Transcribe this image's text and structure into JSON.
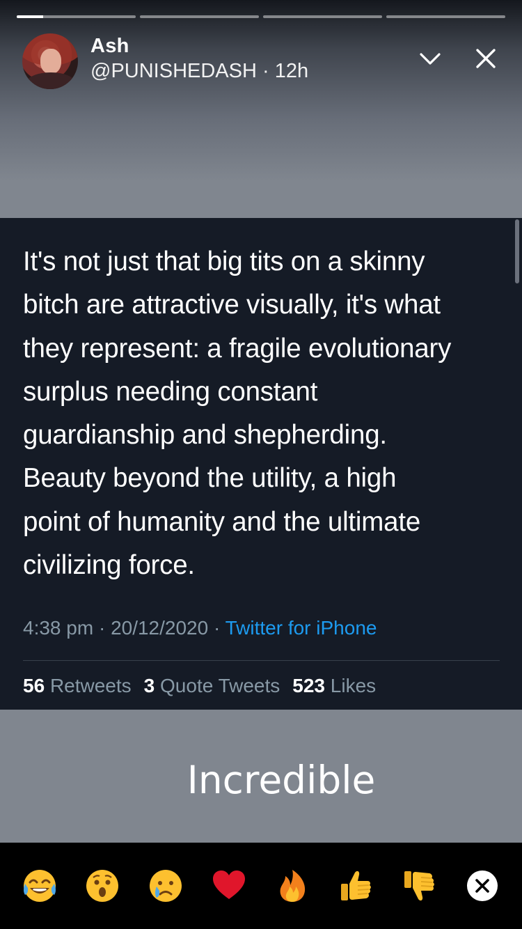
{
  "story": {
    "progress": [
      0.22,
      0,
      0,
      0
    ]
  },
  "header": {
    "name": "Ash",
    "handle": "@PUNISHEDASH",
    "separator": " · ",
    "time": "12h"
  },
  "tweet": {
    "lines": [
      "It's not just that big tits on a skinny",
      "bitch are attractive visually, it's what",
      "they represent: a fragile evolutionary",
      "surplus needing constant",
      "guardianship and shepherding.",
      "Beauty beyond the utility, a high",
      "point of humanity and the ultimate",
      "civilizing force."
    ],
    "time": "4:38 pm",
    "date": "20/12/2020",
    "separator": " · ",
    "source": "Twitter for iPhone",
    "retweets_count": "56",
    "retweets_label": "Retweets",
    "quotes_count": "3",
    "quotes_label": "Quote Tweets",
    "likes_count": "523",
    "likes_label": "Likes"
  },
  "caption": "Incredible",
  "reactions": [
    "tears-of-joy-icon",
    "astonished-icon",
    "crying-icon",
    "heart-icon",
    "fire-icon",
    "thumbs-up-icon",
    "thumbs-down-icon",
    "close-circle-icon"
  ],
  "colors": {
    "tweet_bg": "#151b26",
    "link": "#1d9bf0",
    "meta_gray": "#8899a6",
    "story_bg": "#80868f"
  }
}
